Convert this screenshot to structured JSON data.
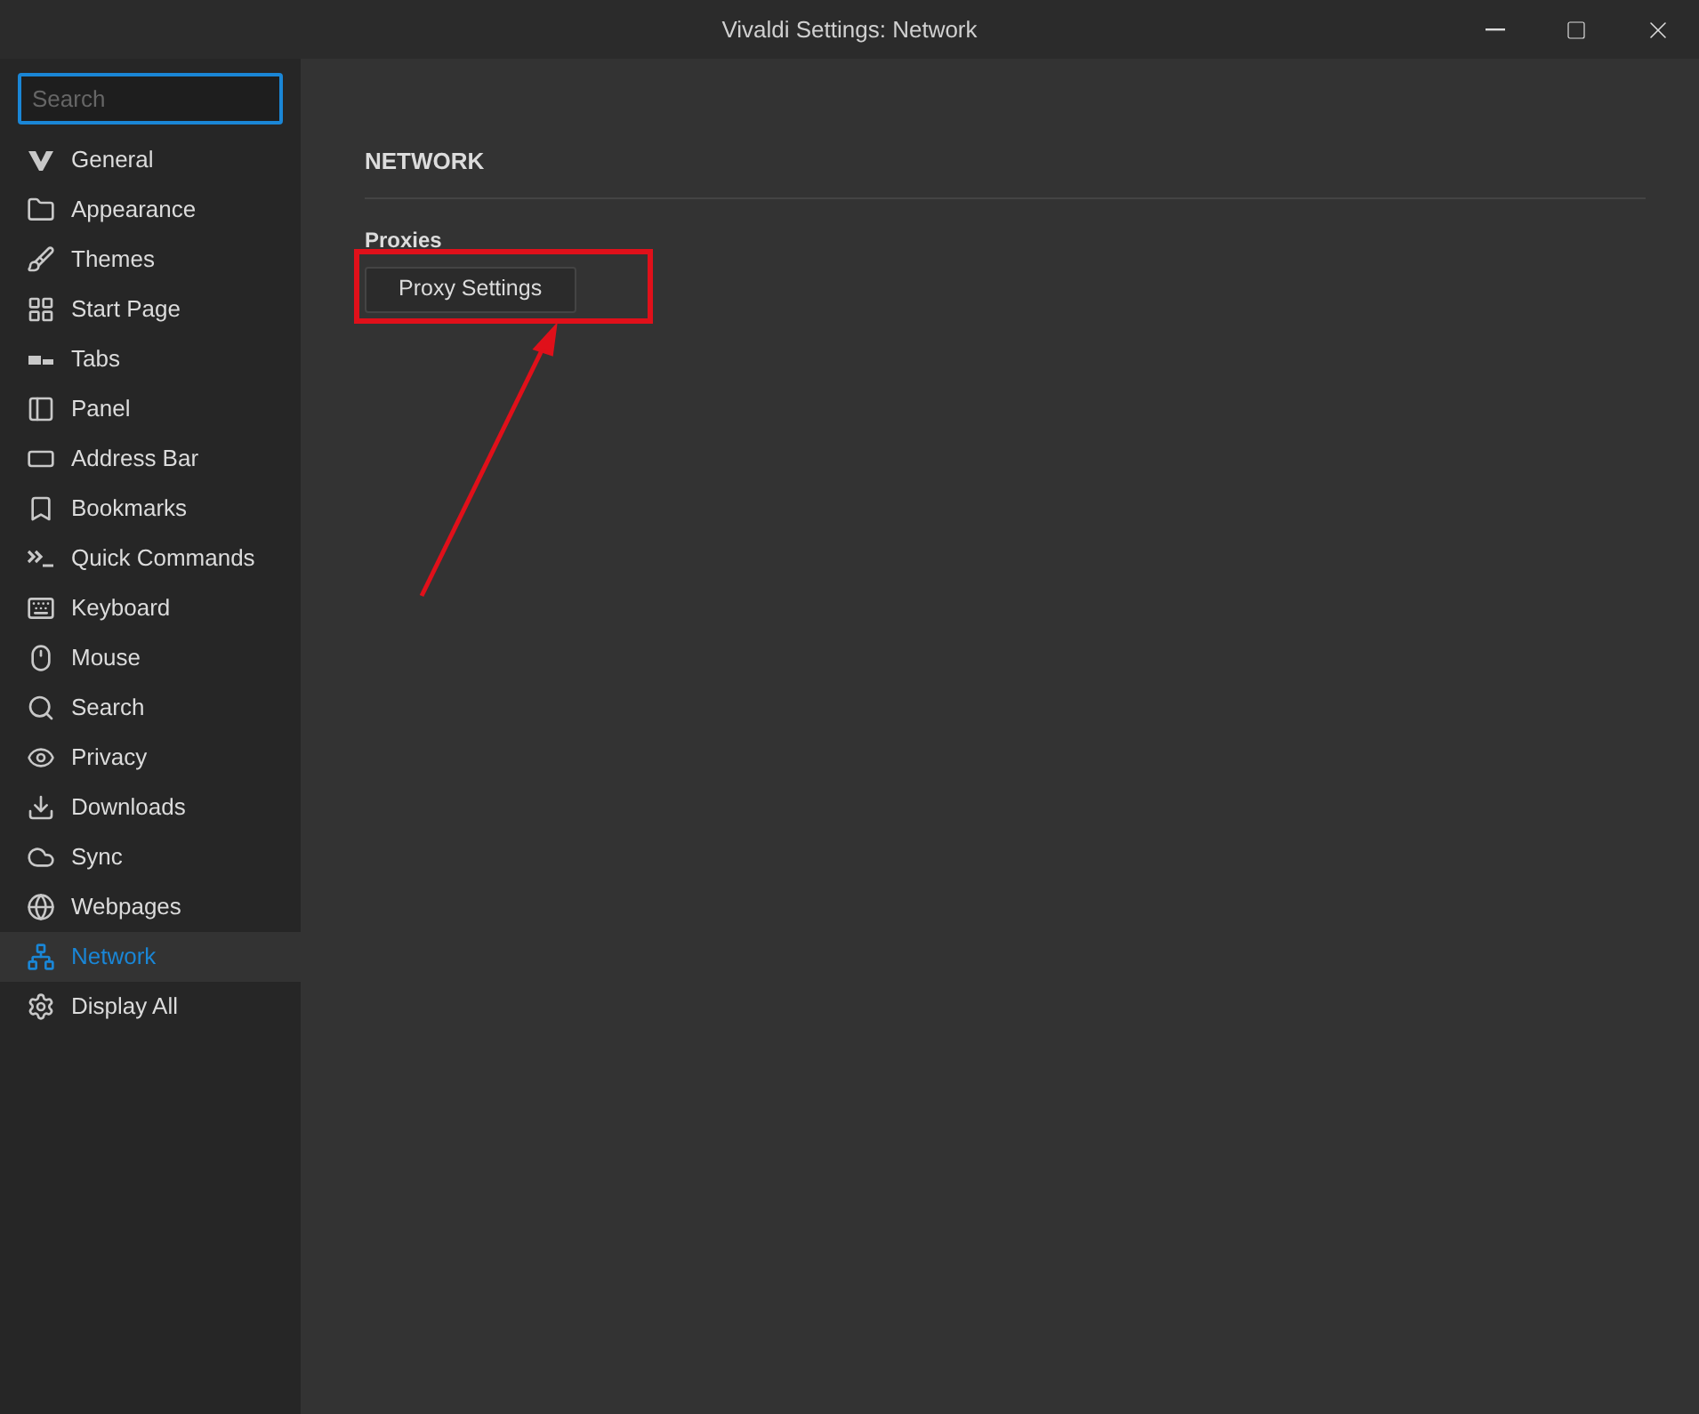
{
  "window": {
    "title": "Vivaldi Settings: Network"
  },
  "sidebar": {
    "search": {
      "placeholder": "Search"
    },
    "items": [
      {
        "label": "General",
        "selected": false
      },
      {
        "label": "Appearance",
        "selected": false
      },
      {
        "label": "Themes",
        "selected": false
      },
      {
        "label": "Start Page",
        "selected": false
      },
      {
        "label": "Tabs",
        "selected": false
      },
      {
        "label": "Panel",
        "selected": false
      },
      {
        "label": "Address Bar",
        "selected": false
      },
      {
        "label": "Bookmarks",
        "selected": false
      },
      {
        "label": "Quick Commands",
        "selected": false
      },
      {
        "label": "Keyboard",
        "selected": false
      },
      {
        "label": "Mouse",
        "selected": false
      },
      {
        "label": "Search",
        "selected": false
      },
      {
        "label": "Privacy",
        "selected": false
      },
      {
        "label": "Downloads",
        "selected": false
      },
      {
        "label": "Sync",
        "selected": false
      },
      {
        "label": "Webpages",
        "selected": false
      },
      {
        "label": "Network",
        "selected": true
      },
      {
        "label": "Display All",
        "selected": false
      }
    ]
  },
  "content": {
    "heading": "NETWORK",
    "section": "Proxies",
    "button": "Proxy Settings"
  }
}
